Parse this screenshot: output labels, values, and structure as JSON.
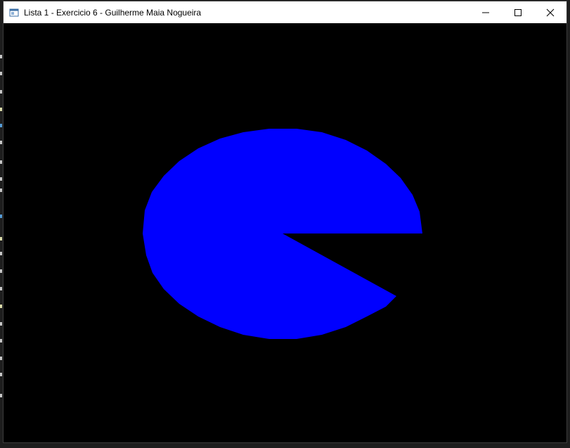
{
  "window": {
    "title": "Lista 1 - Exercicio 6 - Guilherme Maia Nogueira",
    "icon": "app-window-icon",
    "controls": [
      {
        "name": "minimize-button",
        "icon": "minimize-icon"
      },
      {
        "name": "maximize-button",
        "icon": "maximize-icon"
      },
      {
        "name": "close-button",
        "icon": "close-icon"
      }
    ]
  },
  "canvas": {
    "background": "#000000",
    "shape": "pacman",
    "fill": "#0000ff"
  },
  "colors": {
    "titlebar": "#ffffff",
    "title_text": "#000000",
    "background_app": "#1e1e1e"
  }
}
